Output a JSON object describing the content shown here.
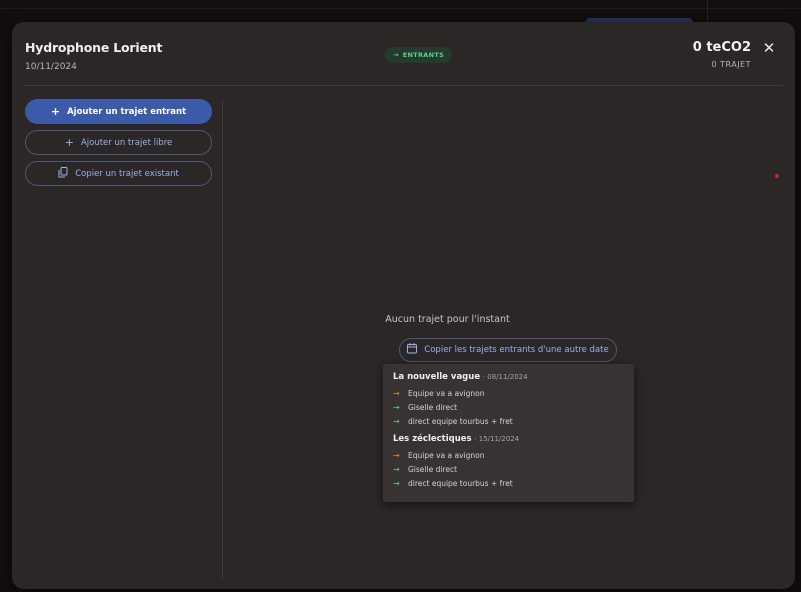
{
  "modal": {
    "title": "Hydrophone Lorient",
    "date": "10/11/2024",
    "direction_badge": {
      "icon": "arrow-right-icon",
      "label": "ENTRANTS",
      "color": "#56d38c"
    },
    "total": "0 teCO2",
    "trip_count": "0 TRAJET",
    "close_icon": "close-icon"
  },
  "sidebar": {
    "add_incoming": "Ajouter un trajet entrant",
    "add_free": "Ajouter un trajet libre",
    "copy_existing": "Copier un trajet existant"
  },
  "main": {
    "empty_text": "Aucun trajet pour l'instant",
    "copy_from_date": "Copier les trajets entrants d'une autre date"
  },
  "dropdown": {
    "groups": [
      {
        "name": "La nouvelle vague",
        "date": "· 08/11/2024",
        "trips": [
          {
            "label": "Equipe va a avignon",
            "arrow_color": "#e08a3a"
          },
          {
            "label": "Giselle direct",
            "arrow_color": "#56d38c"
          },
          {
            "label": "direct equipe tourbus + fret",
            "arrow_color": "#56d38c"
          }
        ]
      },
      {
        "name": "Les zéclectiques",
        "date": "· 15/11/2024",
        "trips": [
          {
            "label": "Equipe va a avignon",
            "arrow_color": "#e08a3a"
          },
          {
            "label": "Giselle direct",
            "arrow_color": "#56d38c"
          },
          {
            "label": "direct equipe tourbus + fret",
            "arrow_color": "#56d38c"
          }
        ]
      }
    ]
  },
  "colors": {
    "primary": "#3b5aa8",
    "accent_text": "#9bb0f2",
    "modal_bg": "#2c2727"
  }
}
